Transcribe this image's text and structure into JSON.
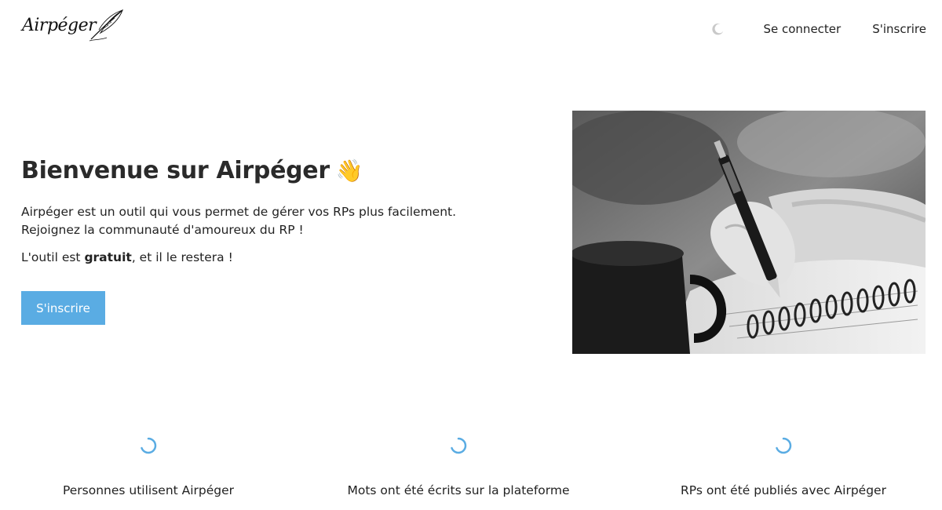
{
  "header": {
    "logo_text": "Airpéger",
    "nav": {
      "theme_toggle": "moon-icon",
      "login_label": "Se connecter",
      "signup_label": "S'inscrire"
    }
  },
  "hero": {
    "title": "Bienvenue sur Airpéger",
    "title_emoji": "👋",
    "description": "Airpéger est un outil qui vous permet de gérer vos RPs plus facilement. Rejoignez la communauté d'amoureux du RP !",
    "free_prefix": "L'outil est ",
    "free_bold": "gratuit",
    "free_suffix": ", et il le restera !",
    "cta_label": "S'inscrire",
    "image_alt": "black-and-white photo of a hand writing in a notebook next to a mug"
  },
  "stats": [
    {
      "label": "Personnes utilisent Airpéger"
    },
    {
      "label": "Mots ont été écrits sur la plateforme"
    },
    {
      "label": "RPs ont été publiés avec Airpéger"
    }
  ],
  "colors": {
    "accent": "#5aace3",
    "text": "#222222",
    "background": "#ffffff"
  }
}
